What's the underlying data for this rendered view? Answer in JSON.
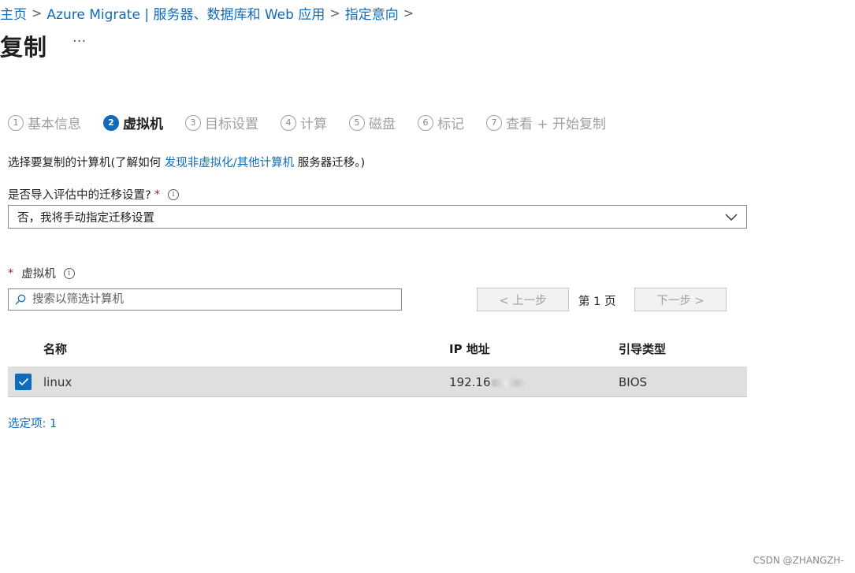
{
  "breadcrumb": {
    "items": [
      "主页",
      "Azure Migrate | 服务器、数据库和 Web 应用",
      "指定意向"
    ],
    "separator": ">"
  },
  "page": {
    "title": "复制",
    "more": "···"
  },
  "steps": [
    {
      "num": "1",
      "label": "基本信息",
      "active": false
    },
    {
      "num": "2",
      "label": "虚拟机",
      "active": true
    },
    {
      "num": "3",
      "label": "目标设置",
      "active": false
    },
    {
      "num": "4",
      "label": "计算",
      "active": false
    },
    {
      "num": "5",
      "label": "磁盘",
      "active": false
    },
    {
      "num": "6",
      "label": "标记",
      "active": false
    },
    {
      "num": "7",
      "label": "查看 + 开始复制",
      "active": false
    }
  ],
  "description": {
    "prefix": "选择要复制的计算机(了解如何 ",
    "link": "发现非虚拟化/其他计算机",
    "suffix": " 服务器迁移。)"
  },
  "import_setting": {
    "label": "是否导入评估中的迁移设置?",
    "required": "*",
    "info": "i",
    "value": "否，我将手动指定迁移设置"
  },
  "vm_section": {
    "required": "*",
    "label": "虚拟机",
    "info": "i",
    "search_placeholder": "搜索以筛选计算机"
  },
  "pager": {
    "prev": "< 上一步",
    "page": "第 1 页",
    "next": "下一步 >"
  },
  "table": {
    "headers": [
      "名称",
      "IP 地址",
      "引导类型"
    ],
    "rows": [
      {
        "name": "linux",
        "ip": "192.16",
        "boot": "BIOS",
        "checked": true
      }
    ]
  },
  "selected": "选定项: 1",
  "watermark": "CSDN @ZHANGZH-",
  "colors": {
    "accent": "#0f6cbd",
    "row_selected": "#e1dfdd",
    "required": "#a4262c"
  }
}
